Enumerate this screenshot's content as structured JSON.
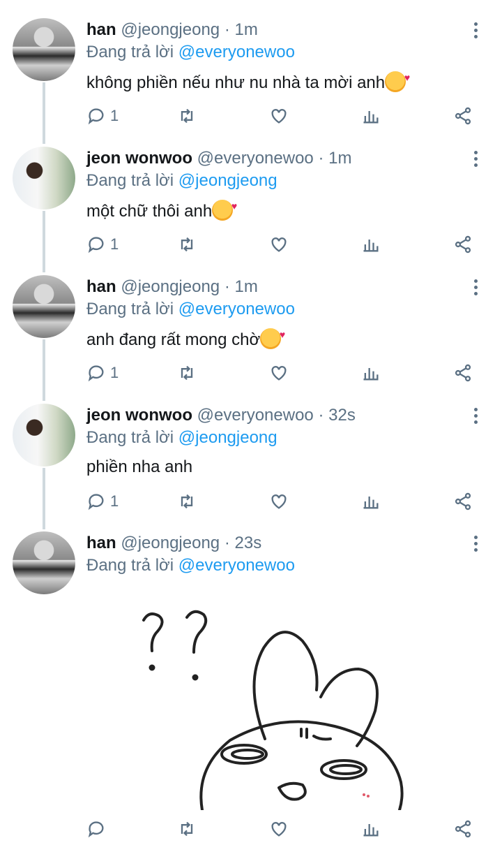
{
  "tweets": [
    {
      "name": "han",
      "handle": "@jeongjeong",
      "sep": "·",
      "time": "1m",
      "reply_prefix": "Đang trả lời",
      "reply_to": "@everyonewoo",
      "text": "không phiền nếu như nu nhà ta mời anh",
      "reply_count": "1"
    },
    {
      "name": "jeon wonwoo",
      "handle": "@everyonewoo",
      "sep": "·",
      "time": "1m",
      "reply_prefix": "Đang trả lời",
      "reply_to": "@jeongjeong",
      "text": "một chữ thôi anh",
      "reply_count": "1"
    },
    {
      "name": "han",
      "handle": "@jeongjeong",
      "sep": "·",
      "time": "1m",
      "reply_prefix": "Đang trả lời",
      "reply_to": "@everyonewoo",
      "text": "anh đang rất mong chờ",
      "reply_count": "1"
    },
    {
      "name": "jeon wonwoo",
      "handle": "@everyonewoo",
      "sep": "·",
      "time": "32s",
      "reply_prefix": "Đang trả lời",
      "reply_to": "@jeongjeong",
      "text": "phiền nha anh",
      "reply_count": "1"
    },
    {
      "name": "han",
      "handle": "@jeongjeong",
      "sep": "·",
      "time": "23s",
      "reply_prefix": "Đang trả lời",
      "reply_to": "@everyonewoo",
      "text": "",
      "reply_count": ""
    }
  ],
  "icons": {
    "reply": "reply-icon",
    "retweet": "retweet-icon",
    "like": "heart-icon",
    "analytics": "analytics-icon",
    "share": "share-icon",
    "menu": "more-vertical-icon",
    "emoji": "smiling-face-with-hearts-icon"
  },
  "colors": {
    "mention": "#1d9bf0",
    "secondary": "#5b7083",
    "thread_line": "#cfd9de"
  }
}
